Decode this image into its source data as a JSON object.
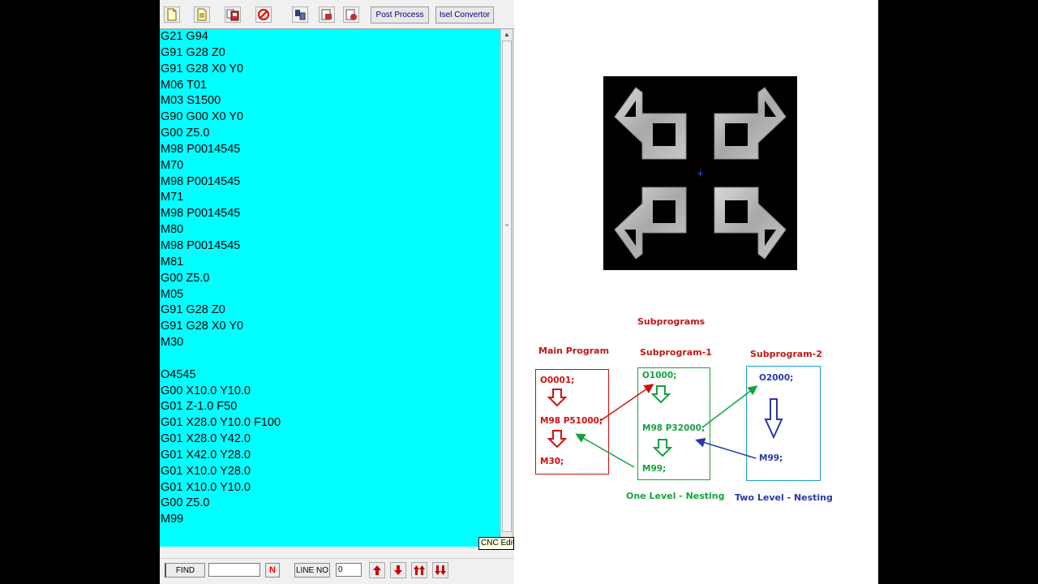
{
  "editor": {
    "toolbar": {
      "post_process_label": "Post Process",
      "isel_convertor_label": "Isel Convertor"
    },
    "code_lines": [
      "G21 G94",
      "G91 G28 Z0",
      "G91 G28 X0 Y0",
      "M06 T01",
      "M03 S1500",
      "G90 G00 X0 Y0",
      "G00 Z5.0",
      "M98 P0014545",
      "M70",
      "M98 P0014545",
      "M71",
      "M98 P0014545",
      "M80",
      "M98 P0014545",
      "M81",
      "G00 Z5.0",
      "M05",
      "G91 G28 Z0",
      "G91 G28 X0 Y0",
      "M30",
      "",
      "O4545",
      "G00 X10.0 Y10.0",
      "G01 Z-1.0 F50",
      "G01 X28.0 Y10.0 F100",
      "G01 X28.0 Y42.0",
      "G01 X42.0 Y28.0",
      "G01 X10.0 Y28.0",
      "G01 X10.0 Y10.0",
      "G00 Z5.0",
      "M99"
    ],
    "tooltip": "CNC Editor",
    "findbar": {
      "find_label": "FIND",
      "find_value": "",
      "n_label": "N",
      "line_no_label": "LINE NO",
      "line_no_value": "0"
    },
    "colors": {
      "code_background": "#00ffff",
      "n_button": "#ff0000",
      "nav_arrows": "#cc0000"
    }
  },
  "diagram": {
    "title": "Subprograms",
    "main_program": {
      "header": "Main Program",
      "lines": [
        "O0001;",
        "M98 P51000;",
        "M30;"
      ],
      "color": "#d01010"
    },
    "subprogram_1": {
      "header": "Subprogram-1",
      "lines": [
        "O1000;",
        "M98 P32000;",
        "M99;"
      ],
      "color": "#18a040"
    },
    "subprogram_2": {
      "header": "Subprogram-2",
      "lines": [
        "O2000;",
        "M99;"
      ],
      "color": "#2a38a8"
    },
    "one_level_label": "One Level - Nesting",
    "two_level_label": "Two Level - Nesting",
    "box2_border_color": "#1aa0c8"
  },
  "icons": [
    "new-file-icon",
    "open-file-icon",
    "save-icon",
    "stop-icon",
    "tool-1-icon",
    "tool-2-icon",
    "tool-3-icon",
    "arrow-up-icon",
    "arrow-down-icon",
    "double-arrow-up-icon",
    "double-arrow-down-icon"
  ]
}
